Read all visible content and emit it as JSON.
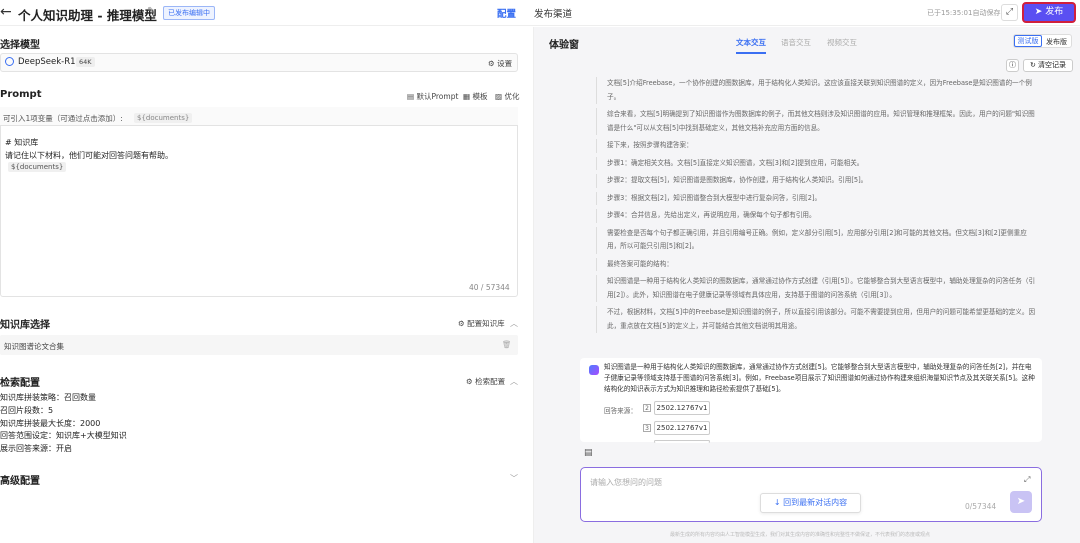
{
  "header": {
    "title": "个人知识助理 - 推理模型",
    "publish_badge": "已发布编辑中",
    "tab_config": "配置",
    "tab_channel": "发布渠道",
    "autosave": "已于15:35:01自动保存",
    "publish_button": "发布"
  },
  "left": {
    "model_section": "选择模型",
    "model_name": "DeepSeek-R1",
    "model_tag": "64K",
    "model_settings": "设置",
    "prompt_section": "Prompt",
    "prompt_default": "默认Prompt",
    "prompt_template": "模板",
    "prompt_optimize": "优化",
    "var_hint": "可引入1项变量（可通过点击添加）:",
    "var_chip": "${documents}",
    "prompt_line1": "# 知识库",
    "prompt_line2": "请记住以下材料，他们可能对回答问题有帮助。",
    "prompt_line3": "${documents}",
    "prompt_count": "40 / 57344",
    "kb_section": "知识库选择",
    "kb_config": "配置知识库",
    "kb_item": "知识图谱论文合集",
    "retrieval_section": "检索配置",
    "retrieval_config": "检索配置",
    "retrieval_lines": [
      "知识库拼装策略：召回数量",
      "召回片段数：5",
      "知识库拼装最大长度：2000",
      "回答范围设定：知识库+大模型知识",
      "展示回答来源：开启"
    ],
    "advanced_section": "高级配置"
  },
  "right": {
    "title": "体验窗",
    "tabs": [
      "文本交互",
      "语音交互",
      "视频交互"
    ],
    "version_test": "测试版",
    "version_publish": "发布版",
    "clear": "清空记录",
    "reasoning": [
      "文档[5]介绍Freebase，一个协作创建的图数据库，用于结构化人类知识。这应该直接关联到知识图谱的定义，因为Freebase是知识图谱的一个例子。",
      "综合来看，文档[5]明确提到了知识图谱作为图数据库的例子，而其他文档则涉及知识图谱的应用。知识管理和推理框架。因此，用户的问题\"知识图谱是什么\"可以从文档[5]中找到基础定义，其他文档补充应用方面的信息。",
      "接下来，按照步骤构建答案：",
      "步骤1：确定相关文档。文档[5]直接定义知识图谱，文档[3]和[2]提到应用，可能相关。",
      "步骤2：提取文档[5]，知识图谱是图数据库，协作创建，用于结构化人类知识。引用[5]。",
      "步骤3：根据文档[2]，知识图谱整合到大模型中进行复杂问答，引用[2]。",
      "步骤4：合并信息，先给出定义，再说明应用，确保每个句子都有引用。",
      "需要检查是否每个句子都正确引用，并且引用编号正确。例如，定义部分引用[5]，应用部分引用[2]和可能的其他文档。但文档[3]和[2]更侧重应用，所以可能只引用[5]和[2]。",
      "最终答案可能的结构：",
      "知识图谱是一种用于结构化人类知识的图数据库，通常通过协作方式创建（引用[5]）。它能够整合到大型语言模型中，辅助处理复杂的问答任务（引用[2]）。此外，知识图谱在电子健康记录等领域有具体应用，支持基于图谱的问答系统（引用[3]）。",
      "不过，根据材料，文档[5]中的Freebase是知识图谱的例子，所以直接引用该部分。可能不需要提到应用，但用户的问题可能希望更基础的定义。因此，重点放在文档[5]的定义上，并可能结合其他文档说明其用途。"
    ],
    "answer": "知识图谱是一种用于结构化人类知识的图数据库，通常通过协作方式创建[5]。它能够整合到大型语言模型中，辅助处理复杂的问答任务[2]，并在电子健康记录等领域支持基于图谱的问答系统[3]。例如，Freebase项目展示了知识图谱如何通过协作构建来组织海量知识节点及其关联关系[5]。这种结构化的知识表示方式为知识推理和路径检索提供了基础[5]。",
    "source_label": "回答来源：",
    "sources": [
      {
        "num": "2",
        "label": "2502.12767v1"
      },
      {
        "num": "3",
        "label": "2502.12767v1"
      }
    ],
    "input_placeholder": "请输入您想问的问题",
    "input_count": "0/57344",
    "latest": "回到最新对话内容",
    "footnote": "最新生成的所有内容均由人工智能模型生成，我们对其生成内容的准确性和完整性不做保证，不代表我们的态度或观点"
  }
}
